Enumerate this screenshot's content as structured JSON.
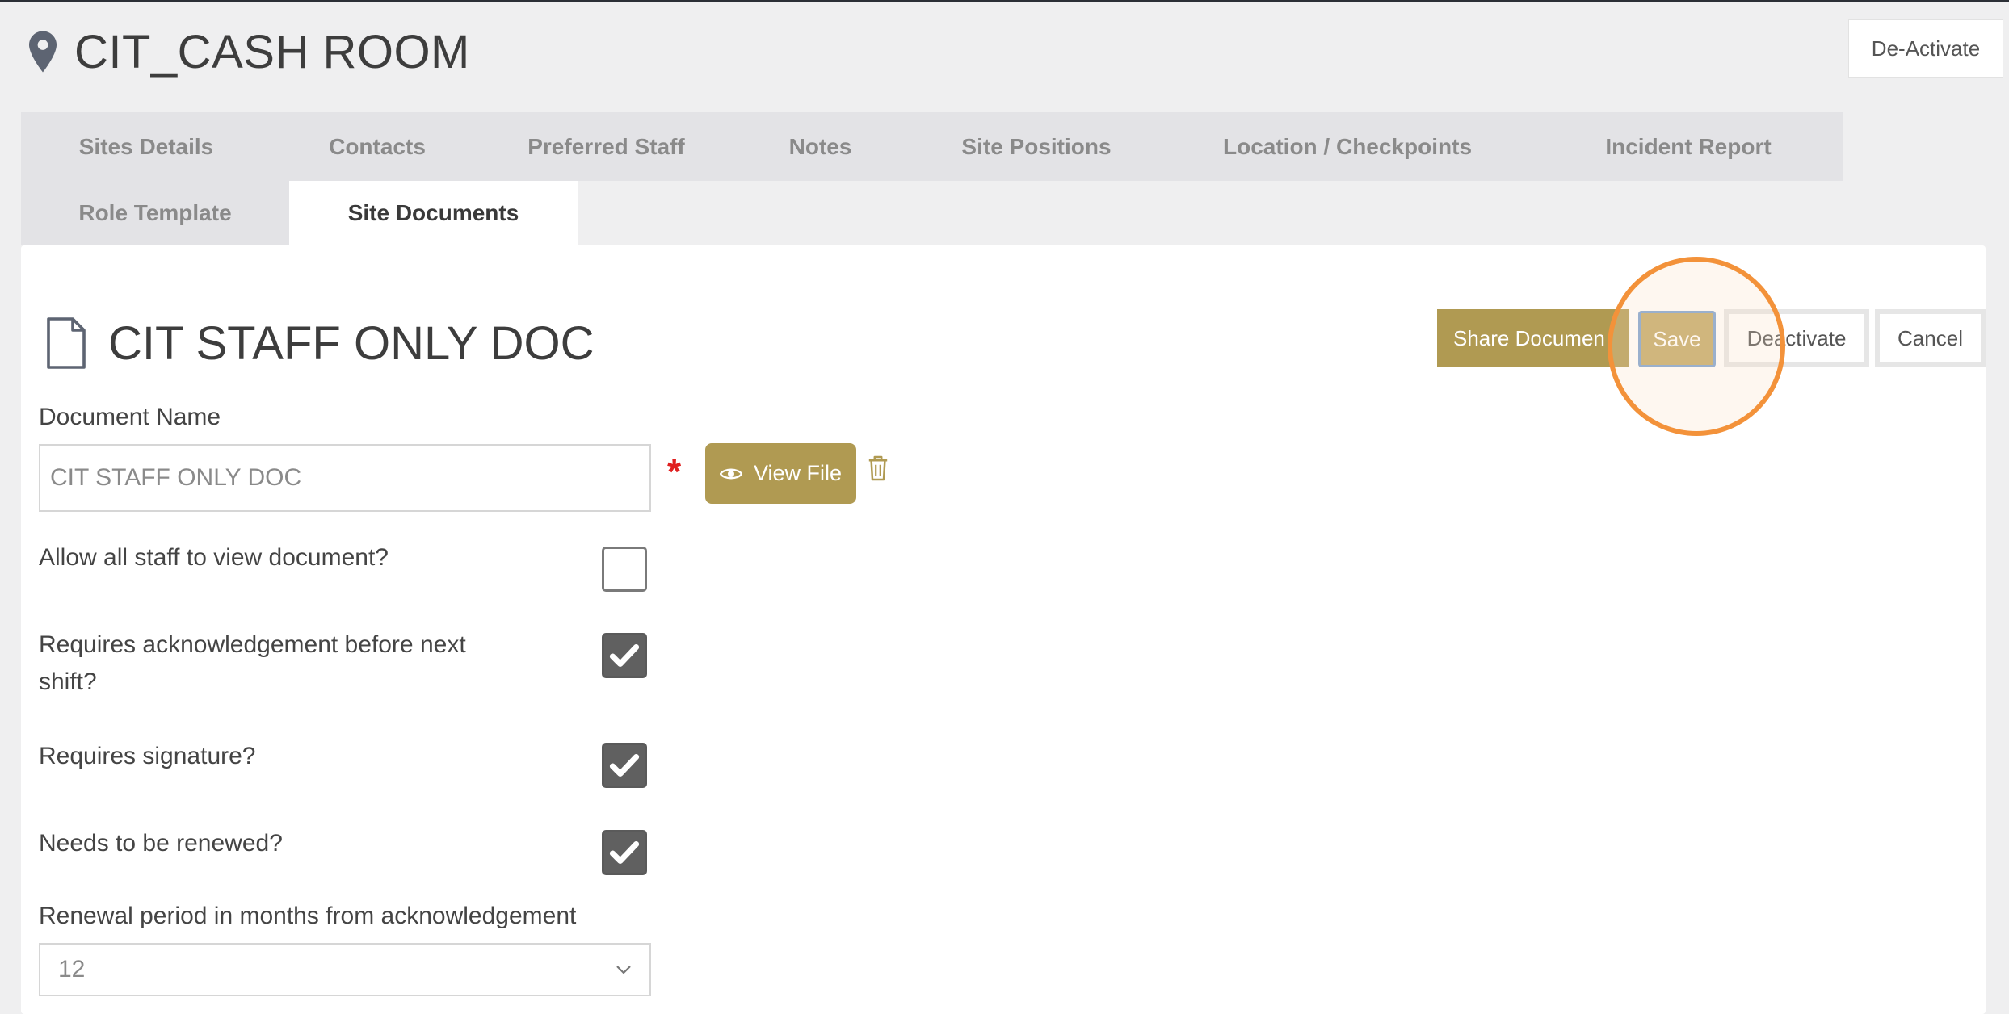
{
  "site": {
    "title": "CIT_CASH ROOM",
    "deactivate_label": "De-Activate"
  },
  "tabs": {
    "row1": [
      "Sites Details",
      "Contacts",
      "Preferred Staff",
      "Notes",
      "Site Positions",
      "Location / Checkpoints",
      "Incident Report"
    ],
    "row2": [
      "Role Template",
      "Site Documents"
    ],
    "active": "Site Documents"
  },
  "document": {
    "title": "CIT STAFF ONLY DOC",
    "actions": {
      "share": "Share Documen",
      "save": "Save",
      "deactivate": "Deactivate",
      "cancel": "Cancel"
    },
    "name_label": "Document Name",
    "name_value": "CIT STAFF ONLY DOC",
    "required_mark": "*",
    "view_file": "View File",
    "options": {
      "allow_all_staff": {
        "label": "Allow all staff to view document?",
        "checked": false
      },
      "requires_ack_line1": "Requires acknowledgement before next",
      "requires_ack_line2": "shift?",
      "requires_ack_checked": true,
      "requires_signature": {
        "label": "Requires signature?",
        "checked": true
      },
      "needs_renewal": {
        "label": "Needs to be renewed?",
        "checked": true
      }
    },
    "renewal_label": "Renewal period in months from acknowledgement",
    "renewal_value": "12"
  },
  "colors": {
    "accent_gold": "#b09a52",
    "save_gold": "#c2a966",
    "highlight_orange": "#f3923a",
    "required_red": "#e02020"
  },
  "icons": {
    "site": "map-pin-icon",
    "document": "document-icon",
    "view": "eye-icon",
    "delete": "trash-icon",
    "dropdown": "chevron-down-icon",
    "check": "checkmark-icon"
  }
}
